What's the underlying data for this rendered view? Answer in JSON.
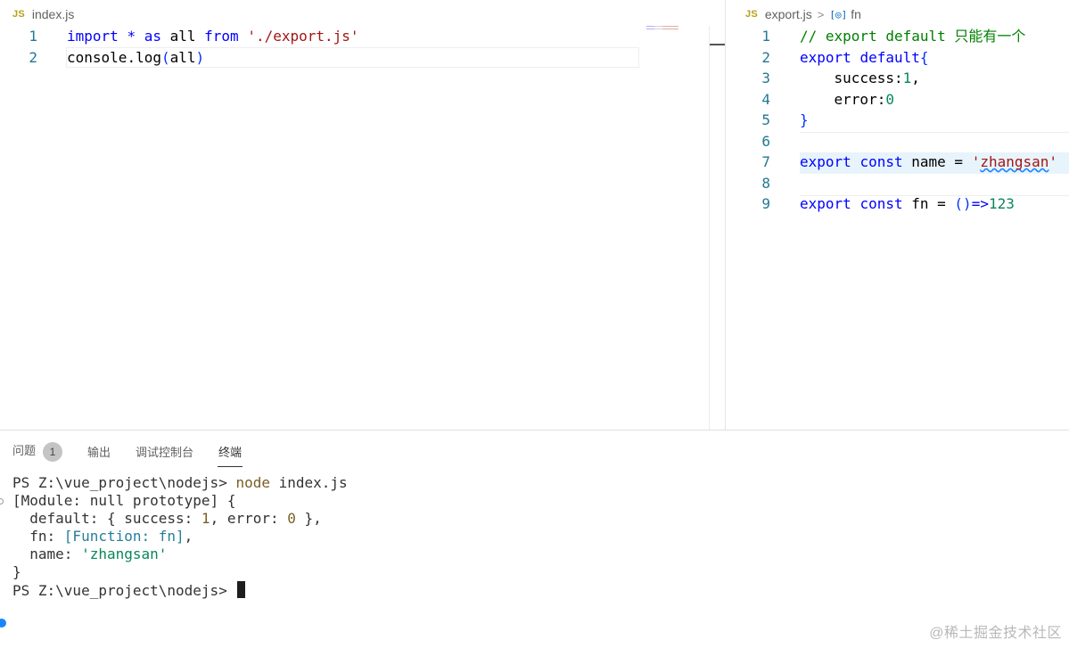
{
  "left_editor": {
    "file_badge": "JS",
    "filename": "index.js",
    "lines": [
      {
        "num": "1",
        "tokens": [
          {
            "t": "import",
            "c": "kw"
          },
          {
            "t": " ",
            "c": ""
          },
          {
            "t": "*",
            "c": "kw"
          },
          {
            "t": " ",
            "c": ""
          },
          {
            "t": "as",
            "c": "kw"
          },
          {
            "t": " all ",
            "c": "ident"
          },
          {
            "t": "from",
            "c": "kw"
          },
          {
            "t": " ",
            "c": ""
          },
          {
            "t": "'./export.js'",
            "c": "str"
          }
        ]
      },
      {
        "num": "2",
        "tokens": [
          {
            "t": "console",
            "c": "ident"
          },
          {
            "t": ".",
            "c": "ident"
          },
          {
            "t": "log",
            "c": "ident"
          },
          {
            "t": "(",
            "c": "pn"
          },
          {
            "t": "all",
            "c": "ident"
          },
          {
            "t": ")",
            "c": "pn"
          }
        ]
      }
    ]
  },
  "right_editor": {
    "file_badge": "JS",
    "filename": "export.js",
    "breadcrumb_symbol_icon": "[◎]",
    "breadcrumb_symbol": "fn",
    "lines": [
      {
        "num": "1",
        "tokens": [
          {
            "t": "// export default 只能有一个",
            "c": "cmt"
          }
        ]
      },
      {
        "num": "2",
        "tokens": [
          {
            "t": "export",
            "c": "kw"
          },
          {
            "t": " ",
            "c": ""
          },
          {
            "t": "default",
            "c": "kw"
          },
          {
            "t": "{",
            "c": "pn"
          }
        ]
      },
      {
        "num": "3",
        "tokens": [
          {
            "t": "    success",
            "c": "ident"
          },
          {
            "t": ":",
            "c": "ident"
          },
          {
            "t": "1",
            "c": "num"
          },
          {
            "t": ",",
            "c": "ident"
          }
        ]
      },
      {
        "num": "4",
        "tokens": [
          {
            "t": "    error",
            "c": "ident"
          },
          {
            "t": ":",
            "c": "ident"
          },
          {
            "t": "0",
            "c": "num"
          }
        ]
      },
      {
        "num": "5",
        "tokens": [
          {
            "t": "}",
            "c": "pn"
          }
        ]
      },
      {
        "num": "6",
        "tokens": []
      },
      {
        "num": "7",
        "tokens": [
          {
            "t": "export",
            "c": "kw"
          },
          {
            "t": " ",
            "c": ""
          },
          {
            "t": "const",
            "c": "kw"
          },
          {
            "t": " name ",
            "c": "ident"
          },
          {
            "t": "=",
            "c": "ident"
          },
          {
            "t": " ",
            "c": ""
          },
          {
            "t": "'",
            "c": "str"
          },
          {
            "t": "zhangsan",
            "c": "str squiggle"
          },
          {
            "t": "'",
            "c": "str"
          }
        ]
      },
      {
        "num": "8",
        "tokens": []
      },
      {
        "num": "9",
        "tokens": [
          {
            "t": "export",
            "c": "kw"
          },
          {
            "t": " ",
            "c": ""
          },
          {
            "t": "const",
            "c": "kw"
          },
          {
            "t": " fn ",
            "c": "ident"
          },
          {
            "t": "=",
            "c": "ident"
          },
          {
            "t": " ",
            "c": ""
          },
          {
            "t": "()",
            "c": "pn"
          },
          {
            "t": "=>",
            "c": "kw"
          },
          {
            "t": "123",
            "c": "num"
          }
        ]
      }
    ]
  },
  "panel": {
    "tabs": [
      {
        "label": "问题",
        "badge": "1",
        "active": false
      },
      {
        "label": "输出",
        "badge": "",
        "active": false
      },
      {
        "label": "调试控制台",
        "badge": "",
        "active": false
      },
      {
        "label": "终端",
        "badge": "",
        "active": true
      }
    ],
    "terminal_lines": [
      [
        {
          "t": "PS Z:\\vue_project\\nodejs> ",
          "c": ""
        },
        {
          "t": "node",
          "c": "t-cmd"
        },
        {
          "t": " index.js",
          "c": ""
        }
      ],
      [
        {
          "t": "[Module: null prototype] {",
          "c": ""
        }
      ],
      [
        {
          "t": "  default: { success: ",
          "c": ""
        },
        {
          "t": "1",
          "c": "t-num"
        },
        {
          "t": ", error: ",
          "c": ""
        },
        {
          "t": "0",
          "c": "t-num"
        },
        {
          "t": " },",
          "c": ""
        }
      ],
      [
        {
          "t": "  fn: ",
          "c": ""
        },
        {
          "t": "[Function: fn]",
          "c": "t-fn"
        },
        {
          "t": ",",
          "c": ""
        }
      ],
      [
        {
          "t": "  name: ",
          "c": ""
        },
        {
          "t": "'zhangsan'",
          "c": "t-str"
        }
      ],
      [
        {
          "t": "}",
          "c": ""
        }
      ],
      [
        {
          "t": "PS Z:\\vue_project\\nodejs> ",
          "c": ""
        }
      ]
    ]
  },
  "watermark": "@稀土掘金技术社区"
}
